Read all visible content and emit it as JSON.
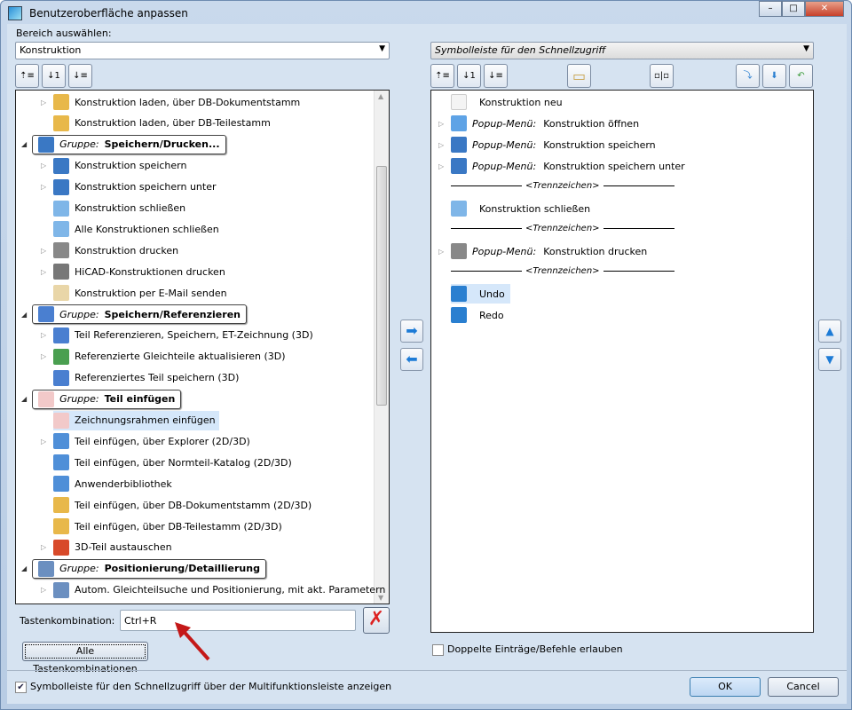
{
  "window": {
    "title": "Benutzeroberfläche anpassen",
    "minimize": "–",
    "maximize": "□",
    "close": "✕"
  },
  "left": {
    "area_label": "Bereich auswählen:",
    "area_value": "Konstruktion",
    "tree": [
      {
        "label": "Konstruktion laden, über DB-Dokumentstamm",
        "exp": true,
        "icon": "folder-db-icon",
        "color": "#e8b84a"
      },
      {
        "label": "Konstruktion laden, über DB-Teilestamm",
        "exp": false,
        "icon": "folder-db-icon",
        "color": "#e8b84a"
      },
      {
        "group": true,
        "prefix": "Gruppe:",
        "label": "Speichern/Drucken...",
        "icon": "floppy-icon",
        "color": "#3a78c4"
      },
      {
        "label": "Konstruktion speichern",
        "exp": true,
        "icon": "floppy-icon",
        "color": "#3a78c4"
      },
      {
        "label": "Konstruktion speichern unter",
        "exp": true,
        "icon": "floppy-pen-icon",
        "color": "#3a78c4"
      },
      {
        "label": "Konstruktion schließen",
        "exp": false,
        "icon": "folder-close-icon",
        "color": "#7fb6e8"
      },
      {
        "label": "Alle Konstruktionen schließen",
        "exp": false,
        "icon": "folders-close-icon",
        "color": "#7fb6e8"
      },
      {
        "label": "Konstruktion drucken",
        "exp": true,
        "icon": "printer-icon",
        "color": "#888"
      },
      {
        "label": "HiCAD-Konstruktionen drucken",
        "exp": true,
        "icon": "printer-icon",
        "color": "#777"
      },
      {
        "label": "Konstruktion per E-Mail senden",
        "exp": false,
        "icon": "email-icon",
        "color": "#e9d6a8"
      },
      {
        "group": true,
        "prefix": "Gruppe:",
        "label": "Speichern/Referenzieren",
        "icon": "reference-icon",
        "color": "#4a7fd0"
      },
      {
        "label": "Teil Referenzieren, Speichern, ET-Zeichnung (3D)",
        "exp": true,
        "icon": "reference-icon",
        "color": "#4a7fd0"
      },
      {
        "label": "Referenzierte Gleichteile aktualisieren (3D)",
        "exp": true,
        "icon": "update-icon",
        "color": "#4a9f50"
      },
      {
        "label": "Referenziertes Teil speichern (3D)",
        "exp": false,
        "icon": "reference-save-icon",
        "color": "#4a7fd0"
      },
      {
        "group": true,
        "prefix": "Gruppe:",
        "label": "Teil einfügen",
        "icon": "drawing-frame-icon",
        "color": "#f2c9c9"
      },
      {
        "label": "Zeichnungsrahmen einfügen",
        "exp": false,
        "icon": "drawing-frame-icon",
        "color": "#f2c9c9",
        "selected": true
      },
      {
        "label": "Teil einfügen, über Explorer (2D/3D)",
        "exp": true,
        "icon": "gear-part-icon",
        "color": "#4f8fd8"
      },
      {
        "label": "Teil einfügen, über Normteil-Katalog (2D/3D)",
        "exp": false,
        "icon": "gear-part-icon",
        "color": "#4f8fd8"
      },
      {
        "label": "Anwenderbibliothek",
        "exp": false,
        "icon": "gear-library-icon",
        "color": "#4f8fd8"
      },
      {
        "label": "Teil einfügen, über DB-Dokumentstamm (2D/3D)",
        "exp": false,
        "icon": "gear-db-icon",
        "color": "#e8b84a"
      },
      {
        "label": "Teil einfügen, über DB-Teilestamm (2D/3D)",
        "exp": false,
        "icon": "gear-db-icon",
        "color": "#e8b84a"
      },
      {
        "label": "3D-Teil austauschen",
        "exp": true,
        "icon": "exchange-part-icon",
        "color": "#d84a2a"
      },
      {
        "group": true,
        "prefix": "Gruppe:",
        "label": "Positionierung/Detaillierung",
        "icon": "positioning-icon",
        "color": "#6b8fc0"
      },
      {
        "label": "Autom. Gleichteilsuche und Positionierung, mit akt. Parametern",
        "exp": true,
        "icon": "positioning-icon",
        "color": "#6b8fc0"
      }
    ],
    "shortcut_label": "Tastenkombination:",
    "shortcut_value": "Ctrl+R",
    "all_shortcuts_button": "Alle Tastenkombinationen"
  },
  "right": {
    "toolbar_value": "Symbolleiste für den Schnellzugriff",
    "items": [
      {
        "label": "Konstruktion neu",
        "icon": "new-document-icon",
        "color": "#f4f4f4"
      },
      {
        "prefix": "Popup-Menü:",
        "label": "Konstruktion öffnen",
        "icon": "folder-open-icon",
        "color": "#5ea3e6",
        "exp": true
      },
      {
        "prefix": "Popup-Menü:",
        "label": "Konstruktion speichern",
        "icon": "floppy-icon",
        "color": "#3a78c4",
        "exp": true
      },
      {
        "prefix": "Popup-Menü:",
        "label": "Konstruktion speichern unter",
        "icon": "floppy-pen-icon",
        "color": "#3a78c4",
        "exp": true
      },
      {
        "separator": "<Trennzeichen>"
      },
      {
        "label": "Konstruktion schließen",
        "icon": "folder-close-icon",
        "color": "#7fb6e8"
      },
      {
        "separator": "<Trennzeichen>"
      },
      {
        "prefix": "Popup-Menü:",
        "label": "Konstruktion drucken",
        "icon": "printer-icon",
        "color": "#888",
        "exp": true
      },
      {
        "separator": "<Trennzeichen>"
      },
      {
        "label": "Undo",
        "icon": "undo-icon",
        "color": "#2a7fd0",
        "selected": true
      },
      {
        "label": "Redo",
        "icon": "redo-icon",
        "color": "#2a7fd0"
      }
    ],
    "allow_duplicates_label": "Doppelte Einträge/Befehle erlauben"
  },
  "footer": {
    "show_qat_label": "Symbolleiste für den Schnellzugriff über der Multifunktionsleiste anzeigen",
    "ok": "OK",
    "cancel": "Cancel"
  }
}
